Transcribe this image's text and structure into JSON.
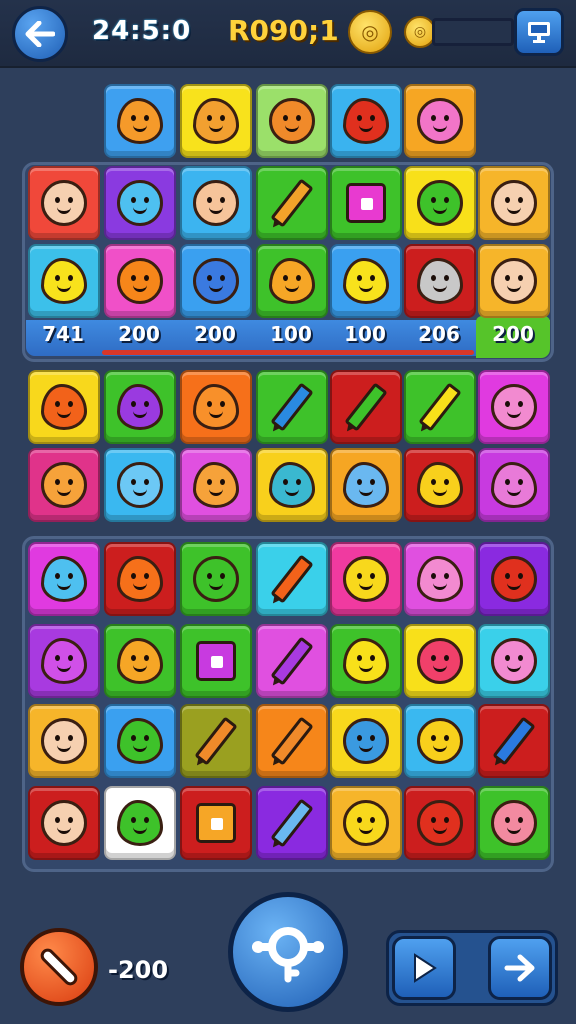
{
  "hud": {
    "timer": "24:5:0",
    "score": "R090;1",
    "back_icon": "arrow-left-icon",
    "coin_icon": "coin-icon",
    "screen_icon": "monitor-icon"
  },
  "score_strip": [
    "741",
    "200",
    "200",
    "100",
    "100",
    "206",
    "200"
  ],
  "bottom": {
    "power_cost": "-200",
    "center_icon": "key-icon",
    "play_icon": "play-icon",
    "next_icon": "arrow-right-icon"
  },
  "board": {
    "top_row": [
      {
        "bg": "#3ea0f0",
        "fg": "#f59a2a",
        "kind": "critter"
      },
      {
        "bg": "#f8e21c",
        "fg": "#f2a030",
        "kind": "critter"
      },
      {
        "bg": "#9be06a",
        "fg": "#f08a2a",
        "kind": "face"
      },
      {
        "bg": "#3ab3ef",
        "fg": "#e0301e",
        "kind": "critter"
      },
      {
        "bg": "#f6a623",
        "fg": "#f275c8",
        "kind": "face"
      }
    ],
    "panel1": [
      [
        {
          "bg": "#f0483a",
          "fg": "#f6d0b0",
          "kind": "face"
        },
        {
          "bg": "#8a3ae0",
          "fg": "#4ec0f0",
          "kind": "face"
        },
        {
          "bg": "#3cb4f0",
          "fg": "#f6c49a",
          "kind": "face"
        },
        {
          "bg": "#3ec22a",
          "fg": "#f2a22a",
          "kind": "pencil"
        },
        {
          "bg": "#3ec22a",
          "fg": "#e83ad0",
          "kind": "box"
        },
        {
          "bg": "#f8e01a",
          "fg": "#3ec22a",
          "kind": "face"
        },
        {
          "bg": "#f6b52a",
          "fg": "#f6d0b0",
          "kind": "face"
        }
      ],
      [
        {
          "bg": "#3cc0ea",
          "fg": "#f8e21c",
          "kind": "critter"
        },
        {
          "bg": "#f050c8",
          "fg": "#f6861a",
          "kind": "face"
        },
        {
          "bg": "#3aa0f0",
          "fg": "#3a7ae0",
          "kind": "face"
        },
        {
          "bg": "#3ec22a",
          "fg": "#f6a626",
          "kind": "critter"
        },
        {
          "bg": "#3aa0f0",
          "fg": "#f8e21c",
          "kind": "critter"
        },
        {
          "bg": "#cc1e1e",
          "fg": "#c8c8c8",
          "kind": "critter"
        },
        {
          "bg": "#f6b52a",
          "fg": "#f6d0b0",
          "kind": "face"
        }
      ]
    ],
    "panel2": [
      [
        {
          "bg": "#f8d81c",
          "fg": "#f2621a",
          "kind": "critter"
        },
        {
          "bg": "#3ec22a",
          "fg": "#9a3ae0",
          "kind": "critter"
        },
        {
          "bg": "#f6701a",
          "fg": "#f8902a",
          "kind": "critter"
        },
        {
          "bg": "#3ec22a",
          "fg": "#2a8ae0",
          "kind": "pencil"
        },
        {
          "bg": "#cc1e1e",
          "fg": "#3ec22a",
          "kind": "pencil"
        },
        {
          "bg": "#3ec22a",
          "fg": "#f8e01a",
          "kind": "pencil"
        },
        {
          "bg": "#e03ae0",
          "fg": "#f28ad0",
          "kind": "face"
        }
      ],
      [
        {
          "bg": "#e0338a",
          "fg": "#f6a23a",
          "kind": "face"
        },
        {
          "bg": "#3ab8f0",
          "fg": "#6cc8f5",
          "kind": "face"
        },
        {
          "bg": "#e050e0",
          "fg": "#f6a23a",
          "kind": "critter"
        },
        {
          "bg": "#f8d01c",
          "fg": "#3ab8d0",
          "kind": "critter"
        },
        {
          "bg": "#f6a623",
          "fg": "#6ab8f0",
          "kind": "critter"
        },
        {
          "bg": "#cc1e1e",
          "fg": "#f8d01c",
          "kind": "critter"
        },
        {
          "bg": "#c83ae0",
          "fg": "#e87ad8",
          "kind": "critter"
        }
      ]
    ],
    "panel3": [
      [
        {
          "bg": "#e03ae0",
          "fg": "#4ec0f0",
          "kind": "critter"
        },
        {
          "bg": "#cc1e1e",
          "fg": "#f6701a",
          "kind": "critter"
        },
        {
          "bg": "#3ec22a",
          "fg": "#3ec22a",
          "kind": "face"
        },
        {
          "bg": "#3ad0ea",
          "fg": "#f2621a",
          "kind": "pencil"
        },
        {
          "bg": "#f03aa0",
          "fg": "#f8d81c",
          "kind": "face"
        },
        {
          "bg": "#e050e0",
          "fg": "#f28ad0",
          "kind": "critter"
        },
        {
          "bg": "#8a2ae0",
          "fg": "#e0301e",
          "kind": "face"
        }
      ],
      [
        {
          "bg": "#a83ae0",
          "fg": "#d050e8",
          "kind": "critter"
        },
        {
          "bg": "#3ec22a",
          "fg": "#f6a626",
          "kind": "critter"
        },
        {
          "bg": "#3ec22a",
          "fg": "#c83ae0",
          "kind": "box"
        },
        {
          "bg": "#e050e0",
          "fg": "#a83ae0",
          "kind": "pencil"
        },
        {
          "bg": "#3ec22a",
          "fg": "#f8e01a",
          "kind": "critter"
        },
        {
          "bg": "#f8e01a",
          "fg": "#f0406a",
          "kind": "face"
        },
        {
          "bg": "#3ad0ea",
          "fg": "#f28ad0",
          "kind": "face"
        }
      ],
      [
        {
          "bg": "#f6b52a",
          "fg": "#f6d0b0",
          "kind": "face"
        },
        {
          "bg": "#3aa0f0",
          "fg": "#3ec22a",
          "kind": "critter"
        },
        {
          "bg": "#9aa020",
          "fg": "#f08a2a",
          "kind": "pencil"
        },
        {
          "bg": "#f6861a",
          "fg": "#f08a2a",
          "kind": "pencil"
        },
        {
          "bg": "#f8d81c",
          "fg": "#3a9ae0",
          "kind": "face"
        },
        {
          "bg": "#3ab8f0",
          "fg": "#f8d01c",
          "kind": "face"
        },
        {
          "bg": "#cc1e1e",
          "fg": "#2a7ae0",
          "kind": "pencil"
        }
      ],
      [
        {
          "bg": "#cc1e1e",
          "fg": "#f6d0b0",
          "kind": "face"
        },
        {
          "bg": "#ffffff",
          "fg": "#3ec22a",
          "kind": "critter"
        },
        {
          "bg": "#cc1e1e",
          "fg": "#f6a626",
          "kind": "box"
        },
        {
          "bg": "#8a2ae0",
          "fg": "#6ab8f0",
          "kind": "pencil"
        },
        {
          "bg": "#f6b52a",
          "fg": "#f8d81c",
          "kind": "face"
        },
        {
          "bg": "#cc1e1e",
          "fg": "#e0301e",
          "kind": "face"
        },
        {
          "bg": "#3ec22a",
          "fg": "#f28aa0",
          "kind": "face"
        }
      ]
    ]
  }
}
